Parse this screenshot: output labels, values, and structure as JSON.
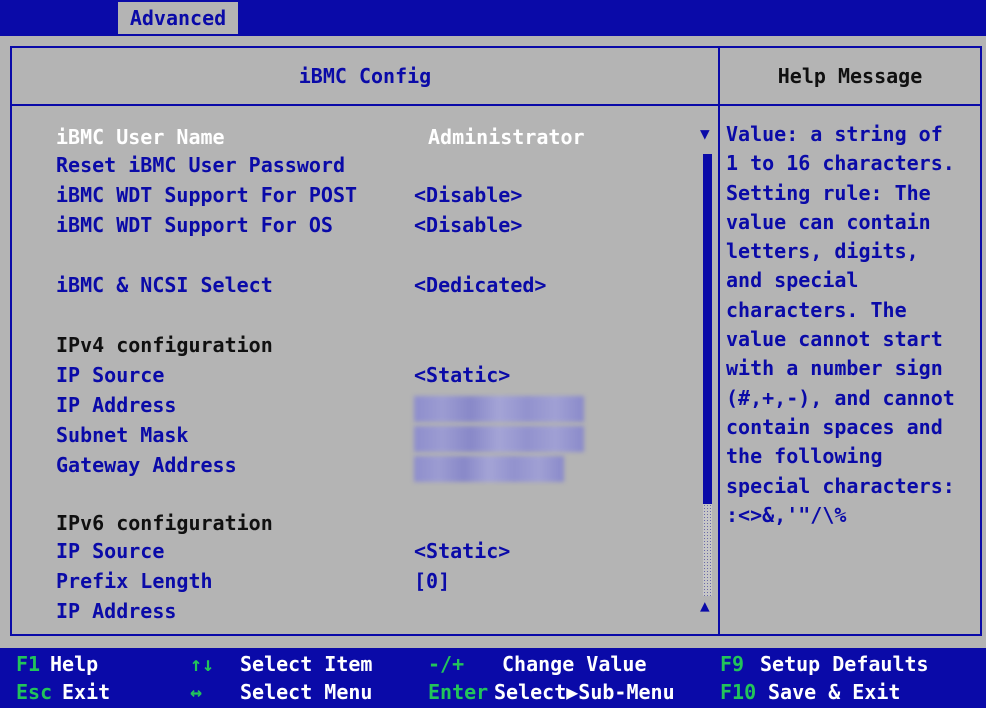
{
  "colors": {
    "background": "#b4b4b4",
    "bar_blue": "#0a0aa8",
    "text_blue": "#0a0aa8",
    "selected_text": "#ffffff",
    "key_green": "#22c45a"
  },
  "top_tabs": [
    {
      "label": "Advanced",
      "active": true
    }
  ],
  "main_panel": {
    "title": "iBMC Config",
    "items": [
      {
        "label": "iBMC User Name",
        "value": "Administrator",
        "selected": true
      },
      {
        "label": "Reset iBMC User Password",
        "value": ""
      },
      {
        "label": "iBMC WDT Support For POST",
        "value": "<Disable>"
      },
      {
        "label": "iBMC WDT Support For OS",
        "value": "<Disable>"
      },
      {
        "label": "iBMC & NCSI Select",
        "value": "<Dedicated>"
      },
      {
        "label": "IPv4 configuration",
        "heading": true
      },
      {
        "label": "IP Source",
        "value": "<Static>"
      },
      {
        "label": "IP Address",
        "value": "",
        "redacted": true
      },
      {
        "label": "Subnet Mask",
        "value": "",
        "redacted": true
      },
      {
        "label": "Gateway Address",
        "value": "",
        "redacted": true
      },
      {
        "label": "IPv6 configuration",
        "heading": true
      },
      {
        "label": "IP Source",
        "value": "<Static>"
      },
      {
        "label": "Prefix Length",
        "value": "[0]"
      },
      {
        "label": "IP Address",
        "value": ""
      }
    ]
  },
  "scrollbar": {
    "up_arrow": "▼",
    "down_arrow": "▲"
  },
  "help_panel": {
    "title": "Help Message",
    "lines": [
      "Value: a string of",
      "1 to 16 characters.",
      "Setting rule: The",
      "value can contain",
      "letters, digits,",
      "and special",
      "characters. The",
      "value cannot start",
      "with a number sign",
      "(#,+,-), and cannot",
      "contain spaces and",
      "the following",
      "special characters:",
      ":<>&,'\"/\\%"
    ]
  },
  "footer": {
    "row1": [
      {
        "key": "F1",
        "desc": "Help"
      },
      {
        "key": "↑↓",
        "desc": "Select Item"
      },
      {
        "key": "-/+",
        "desc": "Change Value"
      },
      {
        "key": "F9",
        "desc": "Setup Defaults"
      }
    ],
    "row2": [
      {
        "key": "Esc",
        "desc": "Exit"
      },
      {
        "key": "↔",
        "desc": "Select Menu"
      },
      {
        "key": "Enter",
        "desc": "Select▶Sub-Menu"
      },
      {
        "key": "F10",
        "desc": "Save & Exit"
      }
    ]
  }
}
